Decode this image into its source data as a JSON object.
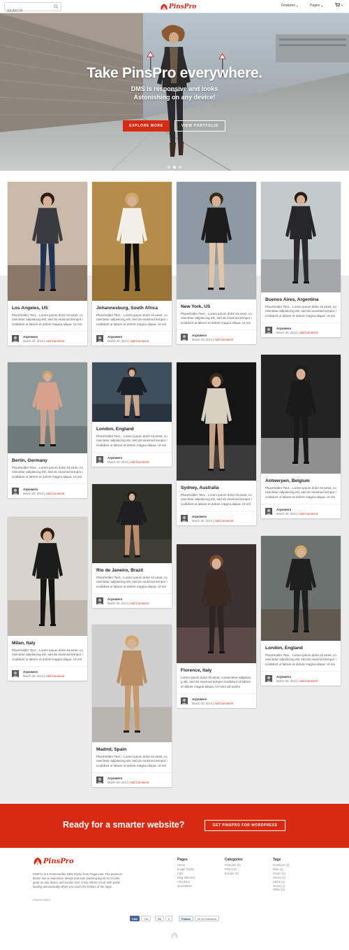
{
  "nav": {
    "search_placeholder": "SEARCH",
    "logo_text": "PinsPro",
    "features_label": "Features",
    "pages_label": "Pages"
  },
  "hero": {
    "title": "Take PinsPro everywhere.",
    "subtitle_line1": "DMS is responsive and looks",
    "subtitle_line2": "Astonishing on any device!",
    "explore_button": "EXPLORE MORE",
    "portfolio_button": "VIEW PORTFOLIO",
    "slide_count": 3,
    "active_slide": 2
  },
  "cards": [
    {
      "location": "Los Angeles, US",
      "description": "Placeholder Text... Lorem ipsum dolor sit amet, co nsectetur adipisicing elit, sed do eiusmod tempor i ncididunt ut labore et dolore magna aliqua. Ut eni m ad minim [...]",
      "author": "Arpowers",
      "date": "March 30, 2014",
      "comment_link": "Add Comment"
    },
    {
      "location": "Johannesburg, South Africa",
      "description": "Placeholder Text... Lorem ipsum dolor sit amet, co nsectetur adipisicing elit, sed do eiusmod tempor i ncididunt ut labore et dolore magna aliqua. Ut eni m ad minim [...]",
      "author": "Arpowers",
      "date": "March 30, 2014",
      "comment_link": "Add Comment"
    },
    {
      "location": "New York, US",
      "description": "Placeholder Text... Lorem ipsum dolor sit amet, co nsectetur adipisicing elit, sed do eiusmod tempor i ncididunt ut labore et dolore magna aliqua. Ut eni m ad minim [...]",
      "author": "Arpowers",
      "date": "March 30, 2014",
      "comment_link": "Add Comment"
    },
    {
      "location": "Buenos Aires, Argentina",
      "description": "Placeholder Text... Lorem ipsum dolor sit amet, co nsectetur adipisicing elit, sed do eiusmod tempor i ncididunt ut labore et dolore magna aliqua. Ut eni m ad minim [...]",
      "author": "Arpowers",
      "date": "March 30, 2014",
      "comment_link": "Add Comment"
    },
    {
      "location": "Berlin, Germany",
      "description": "Placeholder Text... Lorem ipsum dolor sit amet, co nsectetur adipisicing elit, sed do eiusmod tempor i ncididunt ut labore et dolore magna aliqua. Ut eni m ad minim [...]",
      "author": "Arpowers",
      "date": "March 30, 2014",
      "comment_link": "Add Comment"
    },
    {
      "location": "London, England",
      "description": "Placeholder Text... Lorem ipsum dolor sit amet, co nsectetur adipisicing elit, sed do eiusmod tempor i ncididunt ut labore et dolore magna aliqua. Ut eni m ad minim [...]",
      "author": "Arpowers",
      "date": "March 30, 2014",
      "comment_link": "Add Comment"
    },
    {
      "location": "Sydney, Australia",
      "description": "Placeholder Text... Lorem ipsum dolor sit amet, co nsectetur adipisicing elit, sed do eiusmod tempor i ncididunt ut labore et dolore magna aliqua. Ut eni m ad minim [...]",
      "author": "Arpowers",
      "date": "March 30, 2014",
      "comment_link": "Add Comment"
    },
    {
      "location": "Antwerpen, Belgium",
      "description": "Placeholder Text... Lorem ipsum dolor sit amet, co nsectetur adipisicing elit, sed do eiusmod tempor i ncididunt ut labore et dolore magna aliqua. Ut eni m ad minim [...]",
      "author": "Arpowers",
      "date": "March 30, 2014",
      "comment_link": "Add Comment"
    },
    {
      "location": "Milan, Italy",
      "description": "Placeholder Text... Lorem ipsum dolor sit amet, co nsectetur adipisicing elit, sed do eiusmod tempor i ncididunt ut labore et dolore magna aliqua. Ut eni m ad minim [...]",
      "author": "Arpowers",
      "date": "March 30, 2014",
      "comment_link": "Add Comment"
    },
    {
      "location": "Rio de Janeiro, Brazil",
      "description": "Placeholder Text... Lorem ipsum dolor sit amet, co nsectetur adipisicing elit, sed do eiusmod tempor i ncididunt ut labore et dolore magna aliqua. Ut eni m ad minim [...]",
      "author": "Arpowers",
      "date": "March 30, 2014",
      "comment_link": "Add Comment"
    },
    {
      "location": "Florence, Italy",
      "description": "Lorem ipsum dolor sit amet, consectetur adipiscin g elit, sed do eiusmod tempor incididunt ut labore et dolore magna aliqua. Ut enim ad minim veniam, quis [...]",
      "author": "Arpowers",
      "date": "March 30, 2014",
      "comment_link": "Add Comment"
    },
    {
      "location": "London, England",
      "description": "Placeholder Text... Lorem ipsum dolor sit amet, co nsectetur adipisicing elit, sed do eiusmod tempor i ncididunt ut labore et dolore magna aliqua. Ut eni m ad minim [...]",
      "author": "Arpowers",
      "date": "March 30, 2014",
      "comment_link": "Add Comment"
    },
    {
      "location": "Madrid, Spain",
      "description": "Placeholder Text... Lorem ipsum dolor sit amet, co nsectetur adipisicing elit, sed do eiusmod tempor i ncididunt ut labore et dolore magna aliqua. Ut eni m ad minim [...]",
      "author": "Arpowers",
      "date": "March 30, 2014",
      "comment_link": "Add Comment"
    }
  ],
  "cta": {
    "text": "Ready for a smarter website?",
    "button": "GET PINSPRO FOR WORDPRESS"
  },
  "footer": {
    "logo_text": "PinsPro",
    "about": "PinsPro is a Pinterest like DMS theme from PageLines. The premium theme has a responsive design and auto stacking layout so it looks great on any device and screen size. It has infinite scroll, with posts loading automatically when you reach the bottom of the page.",
    "copyright": "PinsPro 2014",
    "pages": {
      "heading": "Pages",
      "items": [
        "Home",
        "Image Styles",
        "Cart",
        "Blog Masonry",
        "Checkout",
        "QuickSlider"
      ]
    },
    "categories": {
      "heading": "Categories",
      "items": [
        "Features (4)",
        "Pins (13)",
        "Europe (4)"
      ]
    },
    "tags": {
      "heading": "Tags",
      "items": [
        "Outdoors (3)",
        "Blue (2)",
        "Green (1)",
        "Shoes (1)",
        "Shirts (1)",
        "Jeans (1)",
        "White (1)"
      ]
    },
    "social": {
      "facebook_label": "Like",
      "facebook_count": "13k",
      "gplus_label": "+1",
      "gplus_count": "6",
      "twitter_label": "Follow",
      "twitter_count": "30.2K followers"
    }
  },
  "colors": {
    "accent": "#d72a13",
    "page_bg": "#ececec"
  }
}
